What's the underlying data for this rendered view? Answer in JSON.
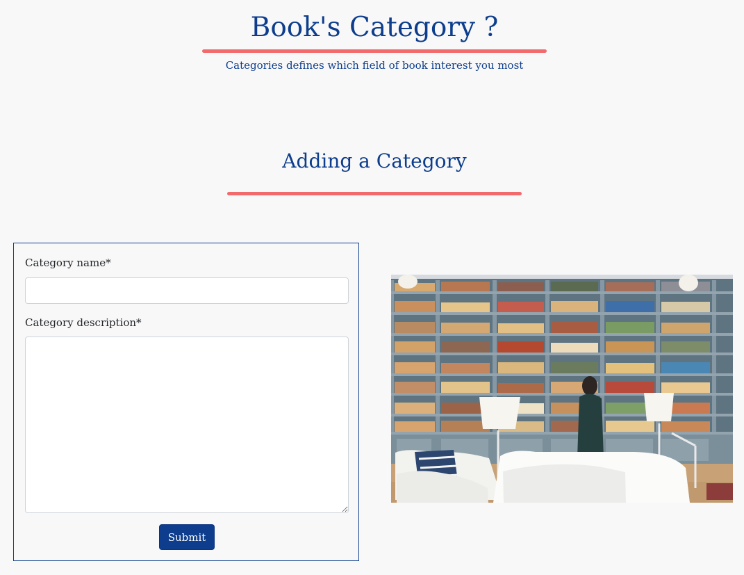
{
  "header": {
    "title": "Book's Category ?",
    "subtitle": "Categories defines which field of book interest you most",
    "accent_color": "#f26a6c",
    "brand_color": "#0d3d8c"
  },
  "section": {
    "title": "Adding a Category"
  },
  "form": {
    "name_label": "Category name*",
    "name_value": "",
    "description_label": "Category description*",
    "description_value": "",
    "submit_label": "Submit"
  },
  "image": {
    "subject": "library bookshelves with white sofa and lamps"
  }
}
